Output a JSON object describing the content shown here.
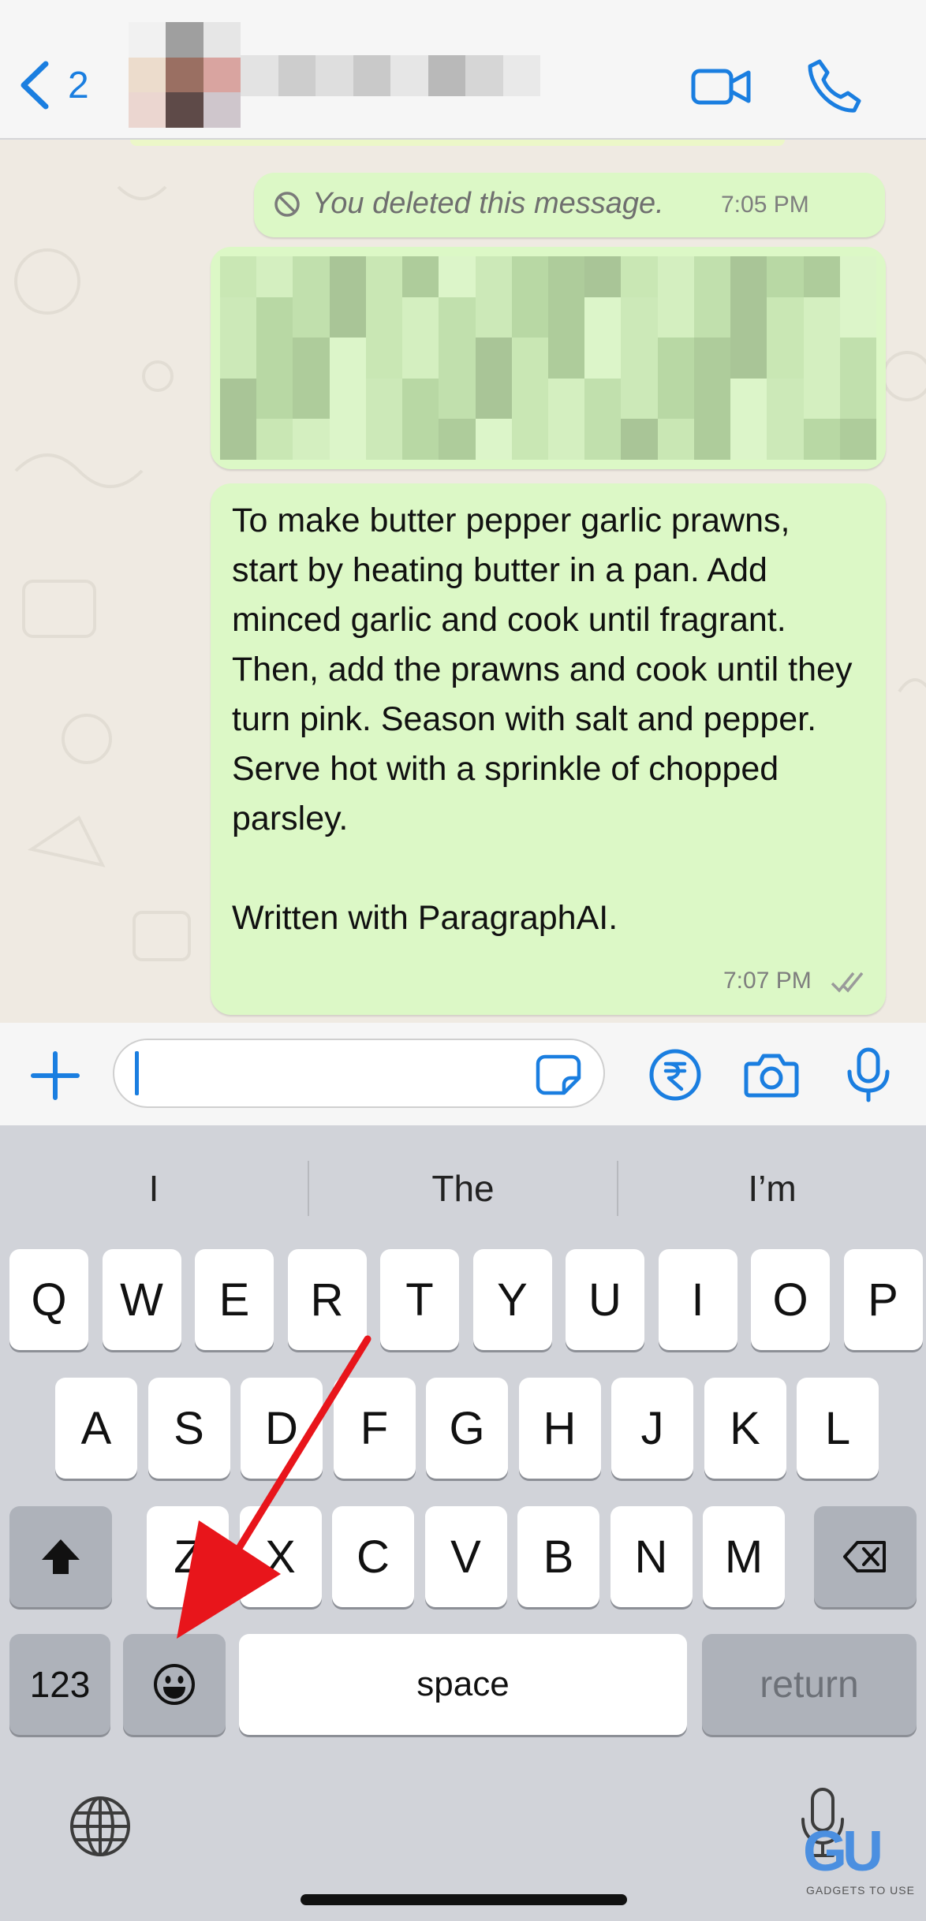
{
  "header": {
    "back_count": "2",
    "contact_name_obscured": true,
    "accent_color": "#1a7ee0"
  },
  "messages": {
    "deleted": {
      "text": "You deleted this message.",
      "time": "7:05 PM"
    },
    "recipe": {
      "text": "To make butter pepper garlic prawns, start by heating butter in a pan. Add minced garlic and cook until fragrant. Then, add the prawns and cook until they turn pink. Season with salt and pepper. Serve hot with a sprinkle of chopped parsley.\n\nWritten with ParagraphAI.",
      "time": "7:07 PM",
      "status": "delivered"
    }
  },
  "input": {
    "value": "",
    "placeholder": ""
  },
  "keyboard": {
    "suggestions": [
      "I",
      "The",
      "I’m"
    ],
    "row1": [
      "Q",
      "W",
      "E",
      "R",
      "T",
      "Y",
      "U",
      "I",
      "O",
      "P"
    ],
    "row2": [
      "A",
      "S",
      "D",
      "F",
      "G",
      "H",
      "J",
      "K",
      "L"
    ],
    "row3": [
      "Z",
      "X",
      "C",
      "V",
      "B",
      "N",
      "M"
    ],
    "numbers_label": "123",
    "space_label": "space",
    "return_label": "return"
  },
  "watermark": {
    "logo": "GU",
    "text": "GADGETS TO USE"
  },
  "annotation": {
    "arrow_color": "#e8151b",
    "target": "emoji-key"
  },
  "icons": [
    "back-chevron-icon",
    "video-call-icon",
    "phone-icon",
    "plus-icon",
    "sticker-icon",
    "rupee-icon",
    "camera-icon",
    "microphone-icon",
    "shift-icon",
    "backspace-icon",
    "emoji-icon",
    "globe-icon",
    "dictation-mic-icon",
    "deleted-icon",
    "double-check-icon"
  ]
}
